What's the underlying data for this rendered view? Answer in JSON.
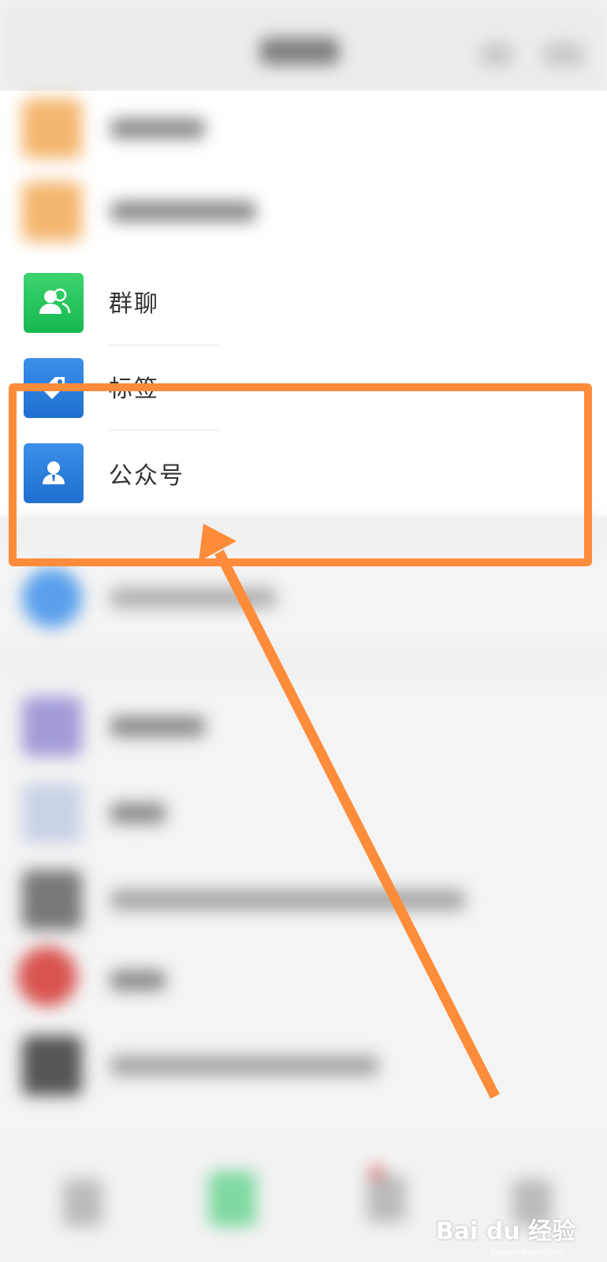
{
  "contacts_menu": {
    "items": [
      {
        "label": "群聊",
        "icon": "group-chat-icon",
        "color": "#1fbf5a"
      },
      {
        "label": "标签",
        "icon": "tag-icon",
        "color": "#2a79d8"
      },
      {
        "label": "公众号",
        "icon": "official-account-icon",
        "color": "#2a79d8"
      }
    ]
  },
  "annotation": {
    "highlight_color": "#ff8c3a",
    "target": "公众号"
  },
  "watermark": {
    "brand": "Bai du 经验",
    "url": "jingyan.baidu.com"
  }
}
